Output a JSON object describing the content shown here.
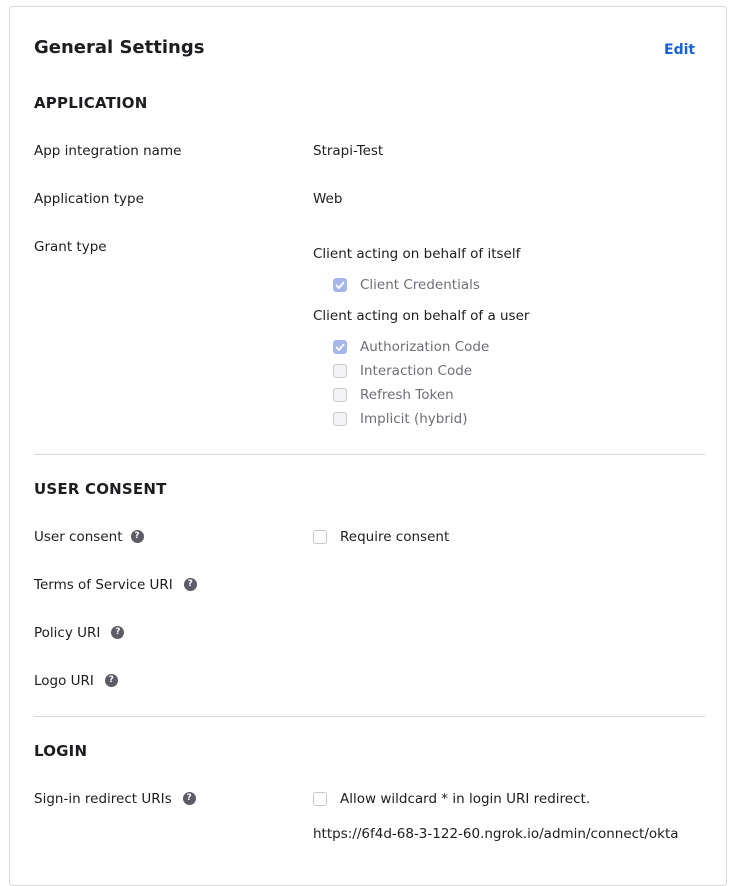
{
  "header": {
    "title": "General Settings",
    "edit_label": "Edit"
  },
  "application": {
    "section_title": "APPLICATION",
    "name_label": "App integration name",
    "name_value": "Strapi-Test",
    "type_label": "Application type",
    "type_value": "Web",
    "grant_label": "Grant type",
    "grant_itself_heading": "Client acting on behalf of itself",
    "grant_user_heading": "Client acting on behalf of a user",
    "grants": [
      {
        "label": "Client Credentials",
        "checked": true
      },
      {
        "label": "Authorization Code",
        "checked": true
      },
      {
        "label": "Interaction Code",
        "checked": false
      },
      {
        "label": "Refresh Token",
        "checked": false
      },
      {
        "label": "Implicit (hybrid)",
        "checked": false
      }
    ]
  },
  "user_consent": {
    "section_title": "USER CONSENT",
    "consent_label": "User consent",
    "require_consent_label": "Require consent",
    "tos_label": "Terms of Service URI",
    "policy_label": "Policy URI",
    "logo_label": "Logo URI"
  },
  "login": {
    "section_title": "LOGIN",
    "redirect_label": "Sign-in redirect URIs",
    "wildcard_label": "Allow wildcard * in login URI redirect.",
    "redirect_uri": "https://6f4d-68-3-122-60.ngrok.io/admin/connect/okta"
  },
  "help_glyph": "?",
  "colors": {
    "accent": "#1662dd",
    "checked": "#a7b6ea",
    "help_icon": "#5c5c66"
  }
}
